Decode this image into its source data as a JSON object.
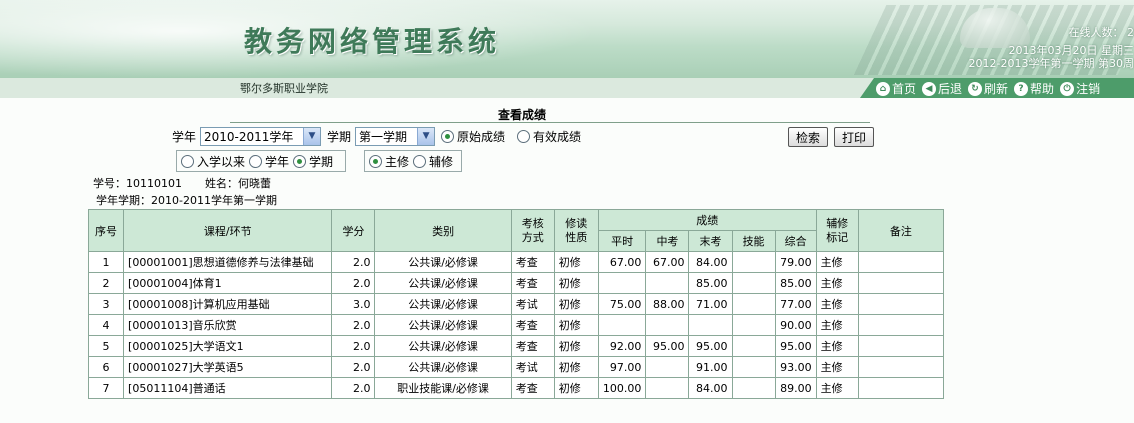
{
  "header": {
    "system_title": "教务网络管理系统",
    "online_users": "在线人数： 2",
    "date": "2013年03月20日 星期三",
    "term_week": "2012-2013学年第一学期 第30周",
    "school": "鄂尔多斯职业学院"
  },
  "nav": [
    {
      "label": "首页",
      "icon": "home-icon",
      "glyph": "⌂"
    },
    {
      "label": "后退",
      "icon": "back-icon",
      "glyph": "◀"
    },
    {
      "label": "刷新",
      "icon": "refresh-icon",
      "glyph": "↻"
    },
    {
      "label": "帮助",
      "icon": "help-icon",
      "glyph": "?"
    },
    {
      "label": "注销",
      "icon": "logout-icon",
      "glyph": "⏻"
    }
  ],
  "page_title": "查看成绩",
  "filters": {
    "year_label": "学年",
    "year_value": "2010-2011学年",
    "term_label": "学期",
    "term_value": "第一学期",
    "grade_type": [
      {
        "label": "原始成绩",
        "checked": true
      },
      {
        "label": "有效成绩",
        "checked": false
      }
    ],
    "scope": [
      {
        "label": "入学以来",
        "checked": false
      },
      {
        "label": "学年",
        "checked": false
      },
      {
        "label": "学期",
        "checked": true
      }
    ],
    "study_type": [
      {
        "label": "主修",
        "checked": true
      },
      {
        "label": "辅修",
        "checked": false
      }
    ],
    "search_button": "检索",
    "print_button": "打印"
  },
  "student": {
    "id_line": "学号：10110101",
    "name_line": "姓名：何晓蕾",
    "term_line": "学年学期：2010-2011学年第一学期"
  },
  "table": {
    "headers": {
      "seq": "序号",
      "course": "课程/环节",
      "credit": "学分",
      "category": "类别",
      "exam_method": "考核方式",
      "study_nature": "修读性质",
      "score_group": "成绩",
      "regular": "平时",
      "midterm": "中考",
      "final": "末考",
      "skill": "技能",
      "total": "综合",
      "minor_flag": "辅修标记",
      "remark": "备注"
    },
    "rows": [
      {
        "seq": "1",
        "course": "[00001001]思想道德修养与法律基础",
        "credit": "2.0",
        "category": "公共课/必修课",
        "exam": "考查",
        "nature": "初修",
        "regular": "67.00",
        "midterm": "67.00",
        "final": "84.00",
        "skill": "",
        "total": "79.00",
        "flag": "主修",
        "remark": ""
      },
      {
        "seq": "2",
        "course": "[00001004]体育1",
        "credit": "2.0",
        "category": "公共课/必修课",
        "exam": "考查",
        "nature": "初修",
        "regular": "",
        "midterm": "",
        "final": "85.00",
        "skill": "",
        "total": "85.00",
        "flag": "主修",
        "remark": ""
      },
      {
        "seq": "3",
        "course": "[00001008]计算机应用基础",
        "credit": "3.0",
        "category": "公共课/必修课",
        "exam": "考试",
        "nature": "初修",
        "regular": "75.00",
        "midterm": "88.00",
        "final": "71.00",
        "skill": "",
        "total": "77.00",
        "flag": "主修",
        "remark": ""
      },
      {
        "seq": "4",
        "course": "[00001013]音乐欣赏",
        "credit": "2.0",
        "category": "公共课/必修课",
        "exam": "考查",
        "nature": "初修",
        "regular": "",
        "midterm": "",
        "final": "",
        "skill": "",
        "total": "90.00",
        "flag": "主修",
        "remark": ""
      },
      {
        "seq": "5",
        "course": "[00001025]大学语文1",
        "credit": "2.0",
        "category": "公共课/必修课",
        "exam": "考查",
        "nature": "初修",
        "regular": "92.00",
        "midterm": "95.00",
        "final": "95.00",
        "skill": "",
        "total": "95.00",
        "flag": "主修",
        "remark": ""
      },
      {
        "seq": "6",
        "course": "[00001027]大学英语5",
        "credit": "2.0",
        "category": "公共课/必修课",
        "exam": "考试",
        "nature": "初修",
        "regular": "97.00",
        "midterm": "",
        "final": "91.00",
        "skill": "",
        "total": "93.00",
        "flag": "主修",
        "remark": ""
      },
      {
        "seq": "7",
        "course": "[05011104]普通话",
        "credit": "2.0",
        "category": "职业技能课/必修课",
        "exam": "考查",
        "nature": "初修",
        "regular": "100.00",
        "midterm": "",
        "final": "84.00",
        "skill": "",
        "total": "89.00",
        "flag": "主修",
        "remark": ""
      }
    ]
  }
}
